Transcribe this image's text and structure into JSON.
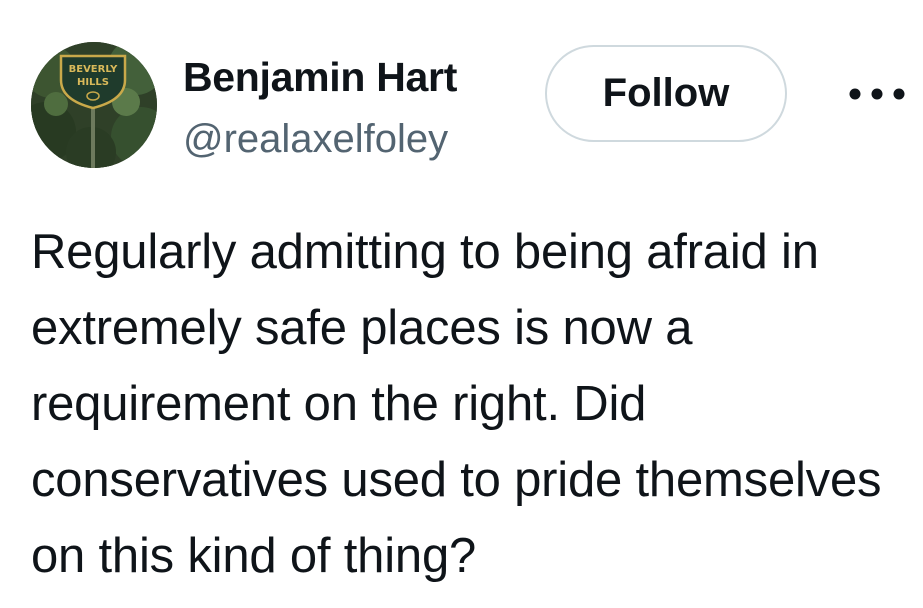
{
  "author": {
    "display_name": "Benjamin Hart",
    "handle": "@realaxelfoley",
    "avatar_sign_text": "BEVERLY HILLS"
  },
  "actions": {
    "follow_label": "Follow",
    "more_icon": "more-horizontal-icon"
  },
  "tweet": {
    "text": "Regularly admitting to being afraid in extremely safe places is now a requirement on the right. Did conservatives used to pride themselves on this kind of thing?"
  },
  "colors": {
    "text_primary": "#0f1419",
    "text_secondary": "#536471",
    "button_border": "#cfd9de",
    "background": "#ffffff"
  }
}
